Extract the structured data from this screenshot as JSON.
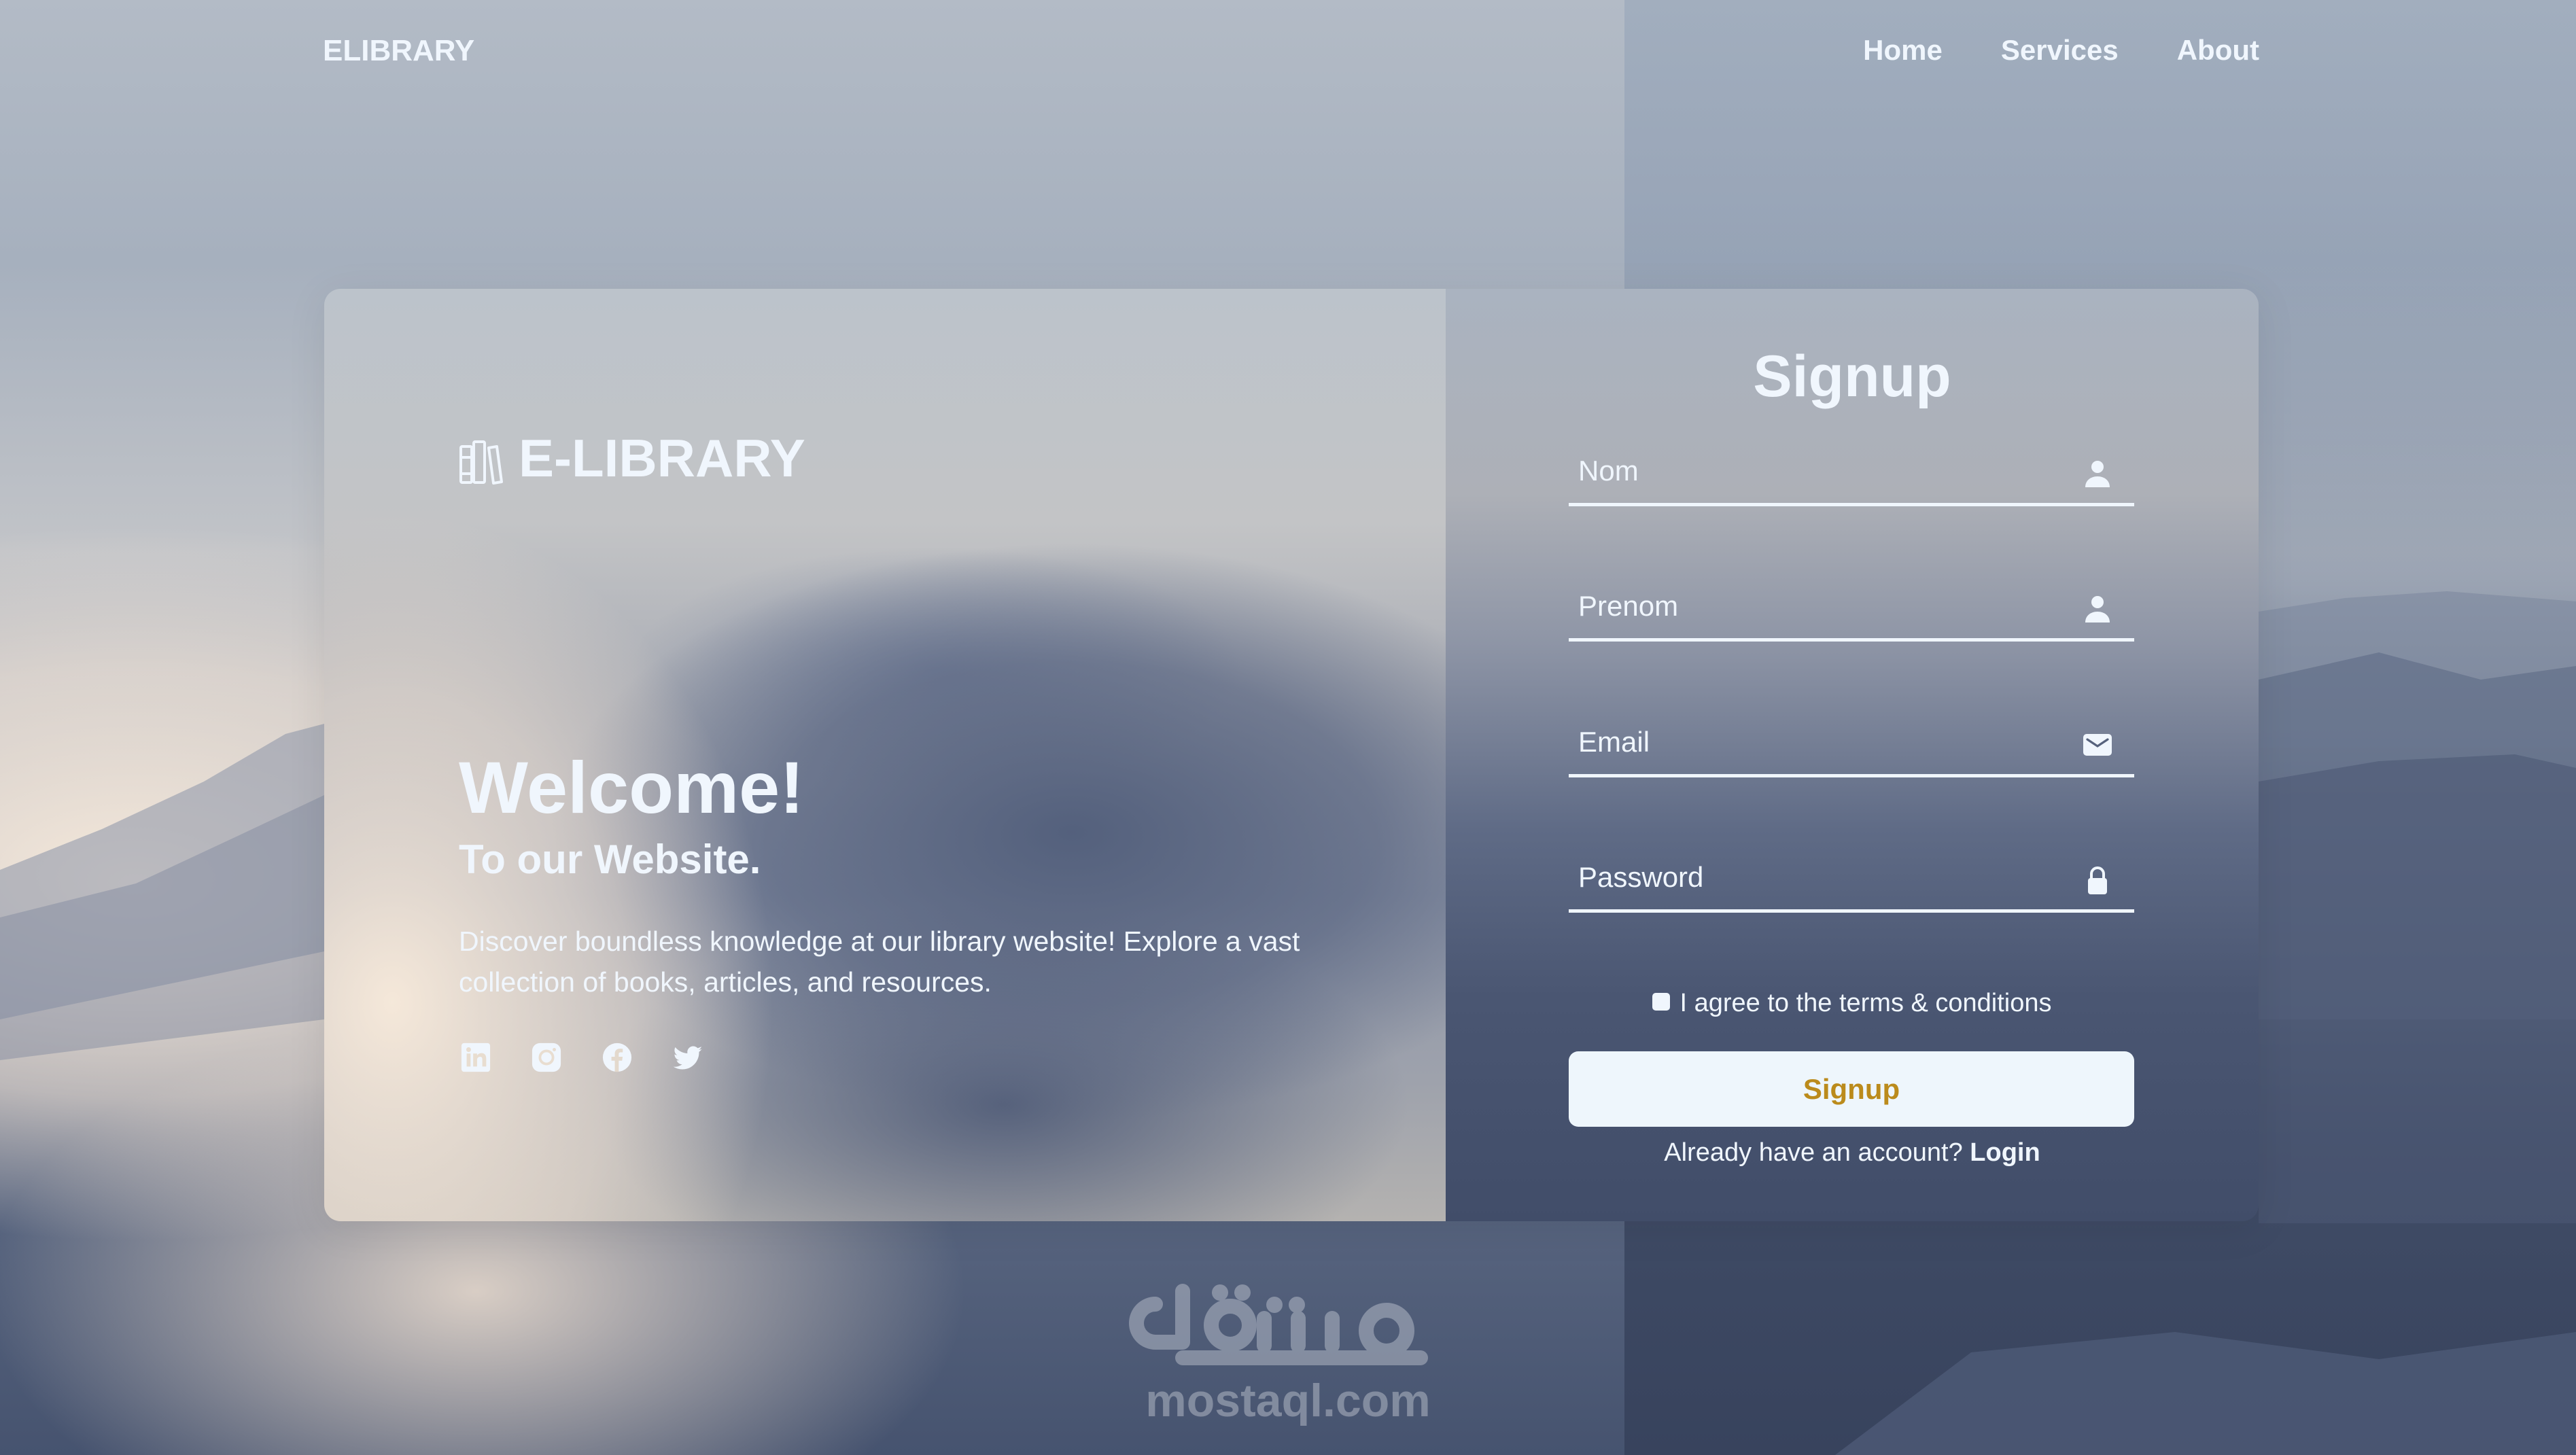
{
  "nav": {
    "logo": "ELIBRARY",
    "links": [
      {
        "label": "Home"
      },
      {
        "label": "Services"
      },
      {
        "label": "About"
      }
    ]
  },
  "hero": {
    "brand": "E-LIBRARY",
    "brand_icon": "books-icon",
    "title": "Welcome!",
    "subtitle": "To our Website.",
    "description": "Discover boundless knowledge at our library website! Explore a vast collection of books, articles, and resources.",
    "socials": [
      {
        "name": "linkedin-icon"
      },
      {
        "name": "instagram-icon"
      },
      {
        "name": "facebook-icon"
      },
      {
        "name": "twitter-icon"
      }
    ]
  },
  "form": {
    "title": "Signup",
    "fields": [
      {
        "placeholder": "Nom",
        "value": "",
        "type": "text",
        "icon": "user-icon"
      },
      {
        "placeholder": "Prenom",
        "value": "",
        "type": "text",
        "icon": "user-icon"
      },
      {
        "placeholder": "Email",
        "value": "",
        "type": "email",
        "icon": "envelope-icon"
      },
      {
        "placeholder": "Password",
        "value": "",
        "type": "password",
        "icon": "lock-icon"
      }
    ],
    "terms_label": "I agree to the terms & conditions",
    "terms_checked": false,
    "submit_label": "Signup",
    "login_prompt": "Already have an account?",
    "login_link": "Login"
  },
  "watermark": {
    "text": "mostaql.com"
  },
  "colors": {
    "text": "#f0f6fd",
    "button_bg": "#eef6fc",
    "button_text": "#bb8b1c"
  }
}
